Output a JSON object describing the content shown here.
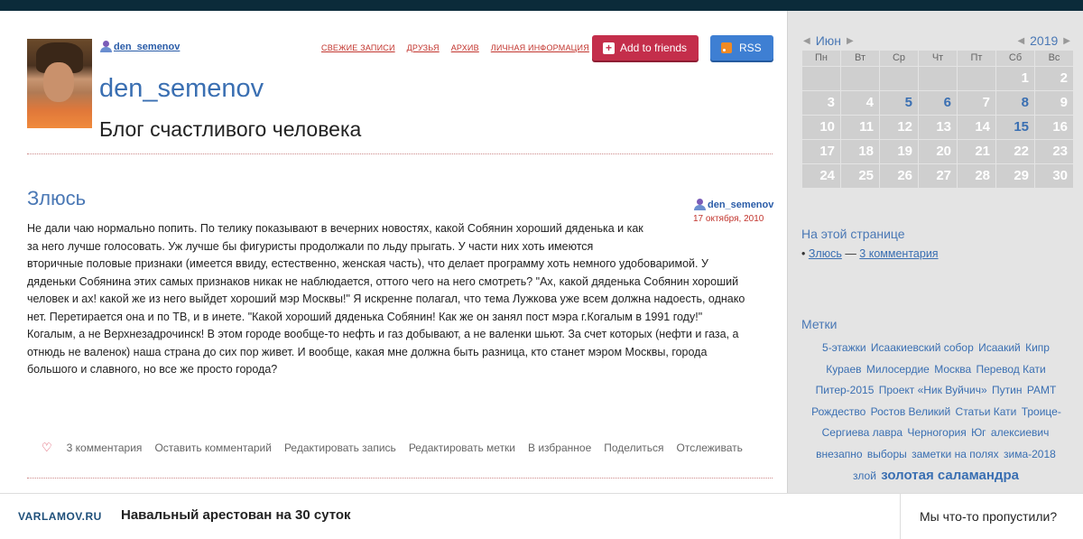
{
  "header": {
    "username": "den_semenov",
    "nav": [
      "СВЕЖИЕ ЗАПИСИ",
      "ДРУЗЬЯ",
      "АРХИВ",
      "ЛИЧНАЯ ИНФОРМАЦИЯ"
    ],
    "add_friends_label": "Add to friends",
    "rss_label": "RSS",
    "blog_name": "den_semenov",
    "blog_description": "Блог счастливого человека"
  },
  "post": {
    "title": "Злюсь",
    "author": "den_semenov",
    "date": "17 октября, 2010",
    "lines": [
      "Не дали чаю нормально попить. По телику показывают в вечерних новостях, какой Собянин хороший дяденька и как",
      "за него лучше голосовать.  Уж лучше бы фигуристы продолжали по льду прыгать.  У части них хоть имеются",
      "вторичные половые признаки (имеется ввиду, естественно, женская часть), что делает программу хоть немного удобоваримой. У",
      "дяденьки Собянина этих самых признаков никак не наблюдается,  оттого чего на него смотреть? \"Ах, какой дяденька Собянин хороший",
      "человек и ах! какой же из него выйдет хороший мэр Москвы!\" Я искренне полагал, что тема Лужкова уже всем должна надоесть, однако",
      "нет. Перетирается она и по ТВ, и в инете. \"Какой хороший дяденька Собянин! Как же он занял пост мэра г.Когалым в 1991 году!\"",
      "Когалым, а не Верхнезадрочинск! В этом городе вообще-то нефть и газ добывают, а не валенки шьют.  За счет которых (нефти и газа, а",
      "отнюдь не валенок) наша страна до сих пор живет. И вообще, какая мне должна быть разница, кто станет мэром Москвы, города",
      "большого и славного, но все же просто города?"
    ],
    "actions": [
      "3 комментария",
      "Оставить комментарий",
      "Редактировать запись",
      "Редактировать метки",
      "В избранное",
      "Поделиться",
      "Отслеживать"
    ]
  },
  "calendar": {
    "month": "Июн",
    "year": "2019",
    "weekdays": [
      "Пн",
      "Вт",
      "Ср",
      "Чт",
      "Пт",
      "Сб",
      "Вс"
    ],
    "weeks": [
      [
        "",
        "",
        "",
        "",
        "",
        "1",
        "2"
      ],
      [
        "3",
        "4",
        "5",
        "6",
        "7",
        "8",
        "9"
      ],
      [
        "10",
        "11",
        "12",
        "13",
        "14",
        "15",
        "16"
      ],
      [
        "17",
        "18",
        "19",
        "20",
        "21",
        "22",
        "23"
      ],
      [
        "24",
        "25",
        "26",
        "27",
        "28",
        "29",
        "30"
      ]
    ],
    "linked_days": [
      "5",
      "6",
      "8",
      "15"
    ]
  },
  "sidebar": {
    "on_page_title": "На этой странице",
    "on_page_item": "Злюсь",
    "on_page_separator": " — ",
    "on_page_comments": "3 комментария",
    "tags_title": "Метки",
    "tags": [
      "5-этажки",
      "Исаакиевский собор",
      "Исаакий",
      "Кипр",
      "Кураев",
      "Милосердие",
      "Москва",
      "Перевод Кати",
      "Питер-2015",
      "Проект «Ник Вуйчич»",
      "Путин",
      "РАМТ",
      "Рождество",
      "Ростов Великий",
      "Статьи Кати",
      "Троице-Сергиева лавра",
      "Черногория",
      "Юг",
      "алексиевич",
      "внезапно",
      "выборы",
      "заметки на полях",
      "зима-2018",
      "злой",
      "золотая саламандра"
    ]
  },
  "footer": {
    "brand": "VARLAMOV.RU",
    "headline": "Навальный арестован на 30 суток",
    "missed": "Мы что-то пропустили?"
  }
}
